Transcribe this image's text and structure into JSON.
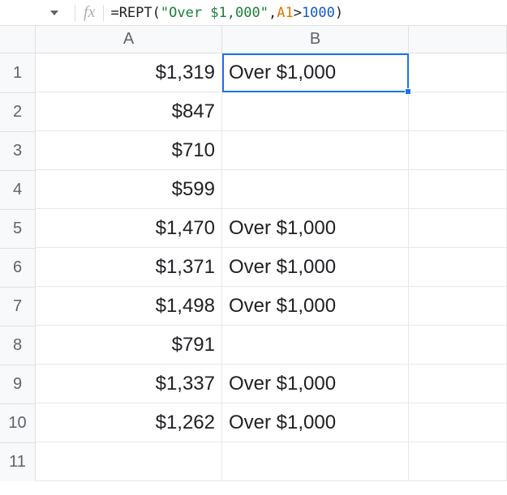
{
  "formula_bar": {
    "fx_label": "fx",
    "tokens": {
      "eq": "=",
      "fn": "REPT",
      "lp": "(",
      "str": "\"Over $1,000\"",
      "comma": ",",
      "ref": "A1",
      "gt": ">",
      "num": "1000",
      "rp": ")"
    }
  },
  "columns": {
    "A": "A",
    "B": "B",
    "C": ""
  },
  "row_labels": [
    "1",
    "2",
    "3",
    "4",
    "5",
    "6",
    "7",
    "8",
    "9",
    "10",
    "11"
  ],
  "rows": [
    {
      "a": "$1,319",
      "b": "Over $1,000"
    },
    {
      "a": "$847",
      "b": ""
    },
    {
      "a": "$710",
      "b": ""
    },
    {
      "a": "$599",
      "b": ""
    },
    {
      "a": "$1,470",
      "b": "Over $1,000"
    },
    {
      "a": "$1,371",
      "b": "Over $1,000"
    },
    {
      "a": "$1,498",
      "b": "Over $1,000"
    },
    {
      "a": "$791",
      "b": ""
    },
    {
      "a": "$1,337",
      "b": "Over $1,000"
    },
    {
      "a": "$1,262",
      "b": "Over $1,000"
    },
    {
      "a": "",
      "b": ""
    }
  ],
  "selection": {
    "col": "B",
    "row": 1
  },
  "chart_data": {
    "type": "table",
    "columns": [
      "A",
      "B"
    ],
    "rows": [
      [
        "$1,319",
        "Over $1,000"
      ],
      [
        "$847",
        ""
      ],
      [
        "$710",
        ""
      ],
      [
        "$599",
        ""
      ],
      [
        "$1,470",
        "Over $1,000"
      ],
      [
        "$1,371",
        "Over $1,000"
      ],
      [
        "$1,498",
        "Over $1,000"
      ],
      [
        "$791",
        ""
      ],
      [
        "$1,337",
        "Over $1,000"
      ],
      [
        "$1,262",
        "Over $1,000"
      ],
      [
        "",
        ""
      ]
    ],
    "formula_B1": "=REPT(\"Over $1,000\",A1>1000)"
  }
}
